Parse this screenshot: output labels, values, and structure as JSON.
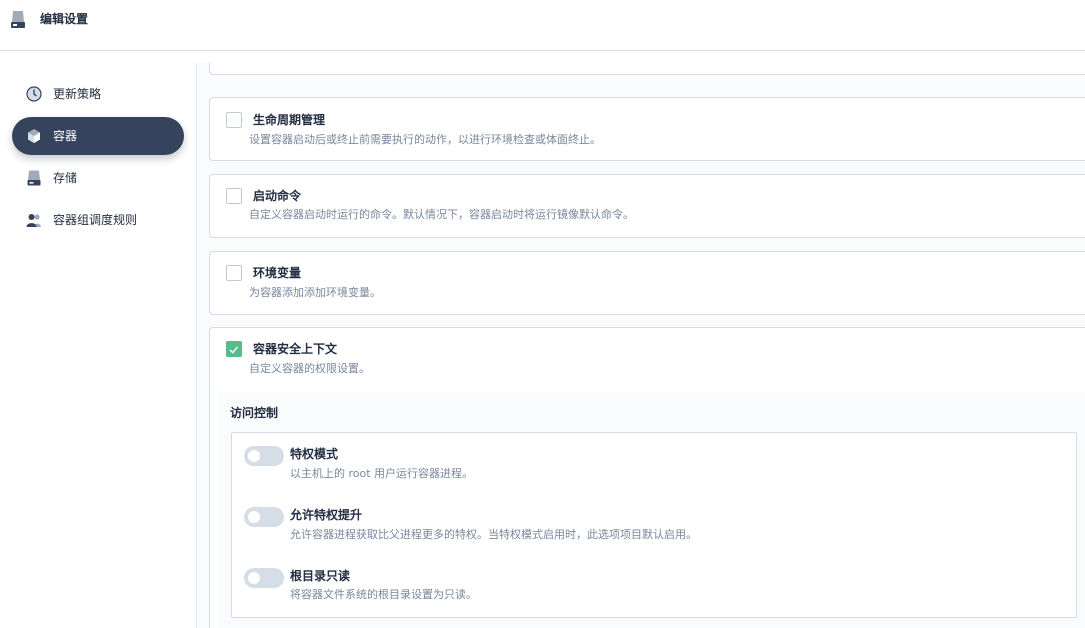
{
  "header": {
    "title": "编辑设置",
    "icon": "storage-icon"
  },
  "sidebar": {
    "items": [
      {
        "label": "更新策略",
        "icon": "clock-icon",
        "active": false
      },
      {
        "label": "容器",
        "icon": "container-icon",
        "active": true
      },
      {
        "label": "存储",
        "icon": "storage-icon",
        "active": false
      },
      {
        "label": "容器组调度规则",
        "icon": "users-icon",
        "active": false
      }
    ]
  },
  "main": {
    "cards": [
      {
        "title": "生命周期管理",
        "description": "设置容器启动后或终止前需要执行的动作，以进行环境检查或体面终止。",
        "checked": false
      },
      {
        "title": "启动命令",
        "description": "自定义容器启动时运行的命令。默认情况下，容器启动时将运行镜像默认命令。",
        "checked": false
      },
      {
        "title": "环境变量",
        "description": "为容器添加添加环境变量。",
        "checked": false
      },
      {
        "title": "容器安全上下文",
        "description": "自定义容器的权限设置。",
        "checked": true
      }
    ],
    "access_control": {
      "title": "访问控制",
      "options": [
        {
          "title": "特权模式",
          "description": "以主机上的 root 用户运行容器进程。",
          "enabled": false
        },
        {
          "title": "允许特权提升",
          "description": "允许容器进程获取比父进程更多的特权。当特权模式启用时，此选项项目默认启用。",
          "enabled": false
        },
        {
          "title": "根目录只读",
          "description": "将容器文件系统的根目录设置为只读。",
          "enabled": false
        }
      ]
    }
  },
  "colors": {
    "accent": "#55bc8a",
    "nav_active": "#36435c",
    "text": "#242e42",
    "muted": "#79879c",
    "border": "#d6dbe5"
  }
}
